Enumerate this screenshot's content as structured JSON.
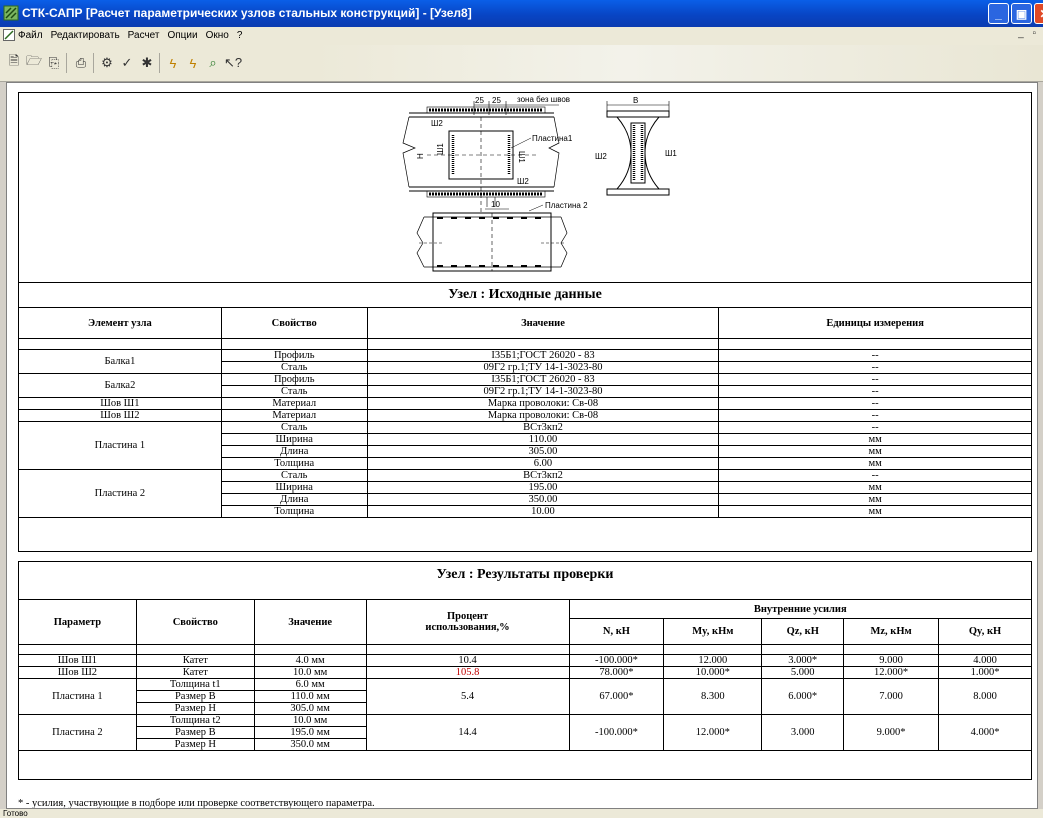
{
  "window": {
    "title": "СТК-САПР [Расчет параметрических узлов стальных конструкций] - [Узел8]"
  },
  "menu": {
    "items": [
      "Файл",
      "Редактировать",
      "Расчет",
      "Опции",
      "Окно",
      "?"
    ]
  },
  "toolbar": {
    "icons": [
      "new-icon",
      "open-icon",
      "copy-icon",
      "print-icon",
      "calc-icon",
      "check-icon",
      "settings-icon",
      "tool-a-icon",
      "tool-b-icon",
      "search-icon",
      "help-icon"
    ]
  },
  "drawing": {
    "labels": {
      "d25a": "25",
      "d25b": "25",
      "zone": "зона без швов",
      "B": "В",
      "plate1": "Пластина1",
      "plate2": "Пластина 2",
      "sh1": "Ш1",
      "sh2": "Ш2",
      "H": "Н",
      "d10": "10"
    }
  },
  "source": {
    "title": "Узел : Исходные данные",
    "headers": [
      "Элемент узла",
      "Свойство",
      "Значение",
      "Единицы измерения"
    ],
    "groups": [
      {
        "element": "Балка1",
        "rows": [
          [
            "Профиль",
            "I35Б1;ГОСТ 26020 - 83",
            "--"
          ],
          [
            "Сталь",
            "09Г2 гр.1;ТУ 14-1-3023-80",
            "--"
          ]
        ]
      },
      {
        "element": "Балка2",
        "rows": [
          [
            "Профиль",
            "I35Б1;ГОСТ 26020 - 83",
            "--"
          ],
          [
            "Сталь",
            "09Г2 гр.1;ТУ 14-1-3023-80",
            "--"
          ]
        ]
      },
      {
        "element": "Шов Ш1",
        "rows": [
          [
            "Материал",
            "Марка проволоки: Св-08",
            "--"
          ]
        ]
      },
      {
        "element": "Шов Ш2",
        "rows": [
          [
            "Материал",
            "Марка проволоки: Св-08",
            "--"
          ]
        ]
      },
      {
        "element": "Пластина 1",
        "rows": [
          [
            "Сталь",
            "ВСт3кп2",
            "--"
          ],
          [
            "Ширина",
            "110.00",
            "мм"
          ],
          [
            "Длина",
            "305.00",
            "мм"
          ],
          [
            "Толщина",
            "6.00",
            "мм"
          ]
        ]
      },
      {
        "element": "Пластина 2",
        "rows": [
          [
            "Сталь",
            "ВСт3кп2",
            "--"
          ],
          [
            "Ширина",
            "195.00",
            "мм"
          ],
          [
            "Длина",
            "350.00",
            "мм"
          ],
          [
            "Толщина",
            "10.00",
            "мм"
          ]
        ]
      }
    ]
  },
  "results": {
    "title": "Узел : Результаты проверки",
    "headers": {
      "param": "Параметр",
      "prop": "Свойство",
      "value": "Значение",
      "percent": "Процент использования,%",
      "forces": "Внутренние усилия",
      "force_cols": [
        "N, кН",
        "My, кНм",
        "Qz, кН",
        "Mz, кНм",
        "Qy, кН"
      ]
    },
    "groups": [
      {
        "param": "Шов Ш1",
        "rows": [
          [
            "Катет",
            "4.0 мм"
          ]
        ],
        "percent": "10.4",
        "percent_alert": false,
        "forces": [
          "-100.000*",
          "12.000",
          "3.000*",
          "9.000",
          "4.000"
        ]
      },
      {
        "param": "Шов Ш2",
        "rows": [
          [
            "Катет",
            "10.0 мм"
          ]
        ],
        "percent": "105.8",
        "percent_alert": true,
        "forces": [
          "78.000*",
          "10.000*",
          "5.000",
          "12.000*",
          "1.000*"
        ]
      },
      {
        "param": "Пластина 1",
        "rows": [
          [
            "Толщина t1",
            "6.0 мм"
          ],
          [
            "Размер В",
            "110.0 мм"
          ],
          [
            "Размер Н",
            "305.0 мм"
          ]
        ],
        "percent": "5.4",
        "percent_alert": false,
        "forces": [
          "67.000*",
          "8.300",
          "6.000*",
          "7.000",
          "8.000"
        ]
      },
      {
        "param": "Пластина 2",
        "rows": [
          [
            "Толщина t2",
            "10.0 мм"
          ],
          [
            "Размер В",
            "195.0 мм"
          ],
          [
            "Размер Н",
            "350.0 мм"
          ]
        ],
        "percent": "14.4",
        "percent_alert": false,
        "forces": [
          "-100.000*",
          "12.000*",
          "3.000",
          "9.000*",
          "4.000*"
        ]
      }
    ]
  },
  "footnote": "* - усилия, участвующие в подборе или проверке соответствующего параметра.",
  "status": "Готово",
  "colors": {
    "titlebar": "#0845c4",
    "alert": "#c00000"
  }
}
